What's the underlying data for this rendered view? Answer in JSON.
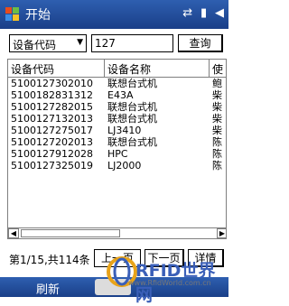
{
  "titlebar": {
    "start_label": "开始",
    "icons": [
      "connectivity-icon",
      "signal-icon",
      "volume-icon"
    ]
  },
  "search": {
    "field_selected": "设备代码",
    "input_value": "127",
    "query_label": "查询"
  },
  "table": {
    "headers": [
      "设备代码",
      "设备名称",
      "使"
    ],
    "rows": [
      {
        "code": "5100127302010",
        "name": "联想台式机",
        "user": "鲍"
      },
      {
        "code": "5100182831312",
        "name": "E43A",
        "user": "柴"
      },
      {
        "code": "5100127282015",
        "name": "联想台式机",
        "user": "柴"
      },
      {
        "code": "5100127132013",
        "name": "联想台式机",
        "user": "柴"
      },
      {
        "code": "5100127275017",
        "name": "LJ3410",
        "user": "柴"
      },
      {
        "code": "5100127202013",
        "name": "联想台式机",
        "user": "陈"
      },
      {
        "code": "5100127912028",
        "name": "HPC",
        "user": "陈"
      },
      {
        "code": "5100127325019",
        "name": "LJ2000",
        "user": "陈"
      }
    ]
  },
  "pager": {
    "info": "第1/15,共114条",
    "prev_label": "上一页",
    "next_label": "下一页",
    "detail_label": "详情"
  },
  "menubar": {
    "refresh_label": "刷新"
  },
  "watermark": {
    "brand": "RFID世界网",
    "url": "www.RfidWorld.com.cn"
  }
}
